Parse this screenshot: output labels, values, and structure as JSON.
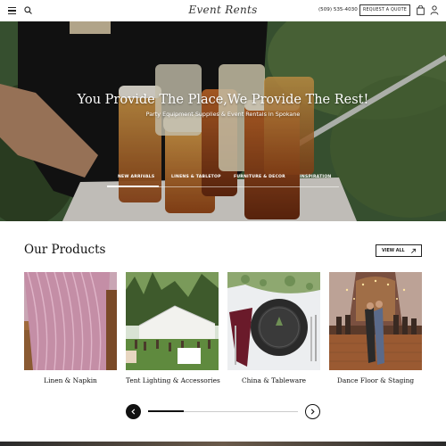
{
  "header": {
    "logo": "Event Rents",
    "phone": "(509) 535-4030",
    "quote_button": "REQUEST A QUOTE",
    "icons": [
      "menu-icon",
      "search-icon",
      "shopping-bag-icon",
      "user-icon"
    ]
  },
  "hero": {
    "title": "You Provide The Place,We Provide The Rest!",
    "subtitle": "Party Equipment Supplies & Event Rentals in Spokane",
    "tabs": [
      {
        "label": "NEW ARRIVALS",
        "active": true
      },
      {
        "label": "LINENS & TABLETOP",
        "active": false
      },
      {
        "label": "FURNITURE & DECOR",
        "active": false
      },
      {
        "label": "INSPIRATION",
        "active": false
      }
    ]
  },
  "products": {
    "title": "Our Products",
    "view_all": "VIEW ALL",
    "items": [
      {
        "label": "Linen & Napkin"
      },
      {
        "label": "Tent Lighting & Accessories"
      },
      {
        "label": "China & Tableware"
      },
      {
        "label": "Dance Floor & Staging"
      }
    ],
    "slider_progress": 0.24
  },
  "colors": {
    "text": "#111111",
    "hero_green": "#3d5a2e",
    "button_dark": "#111111"
  }
}
